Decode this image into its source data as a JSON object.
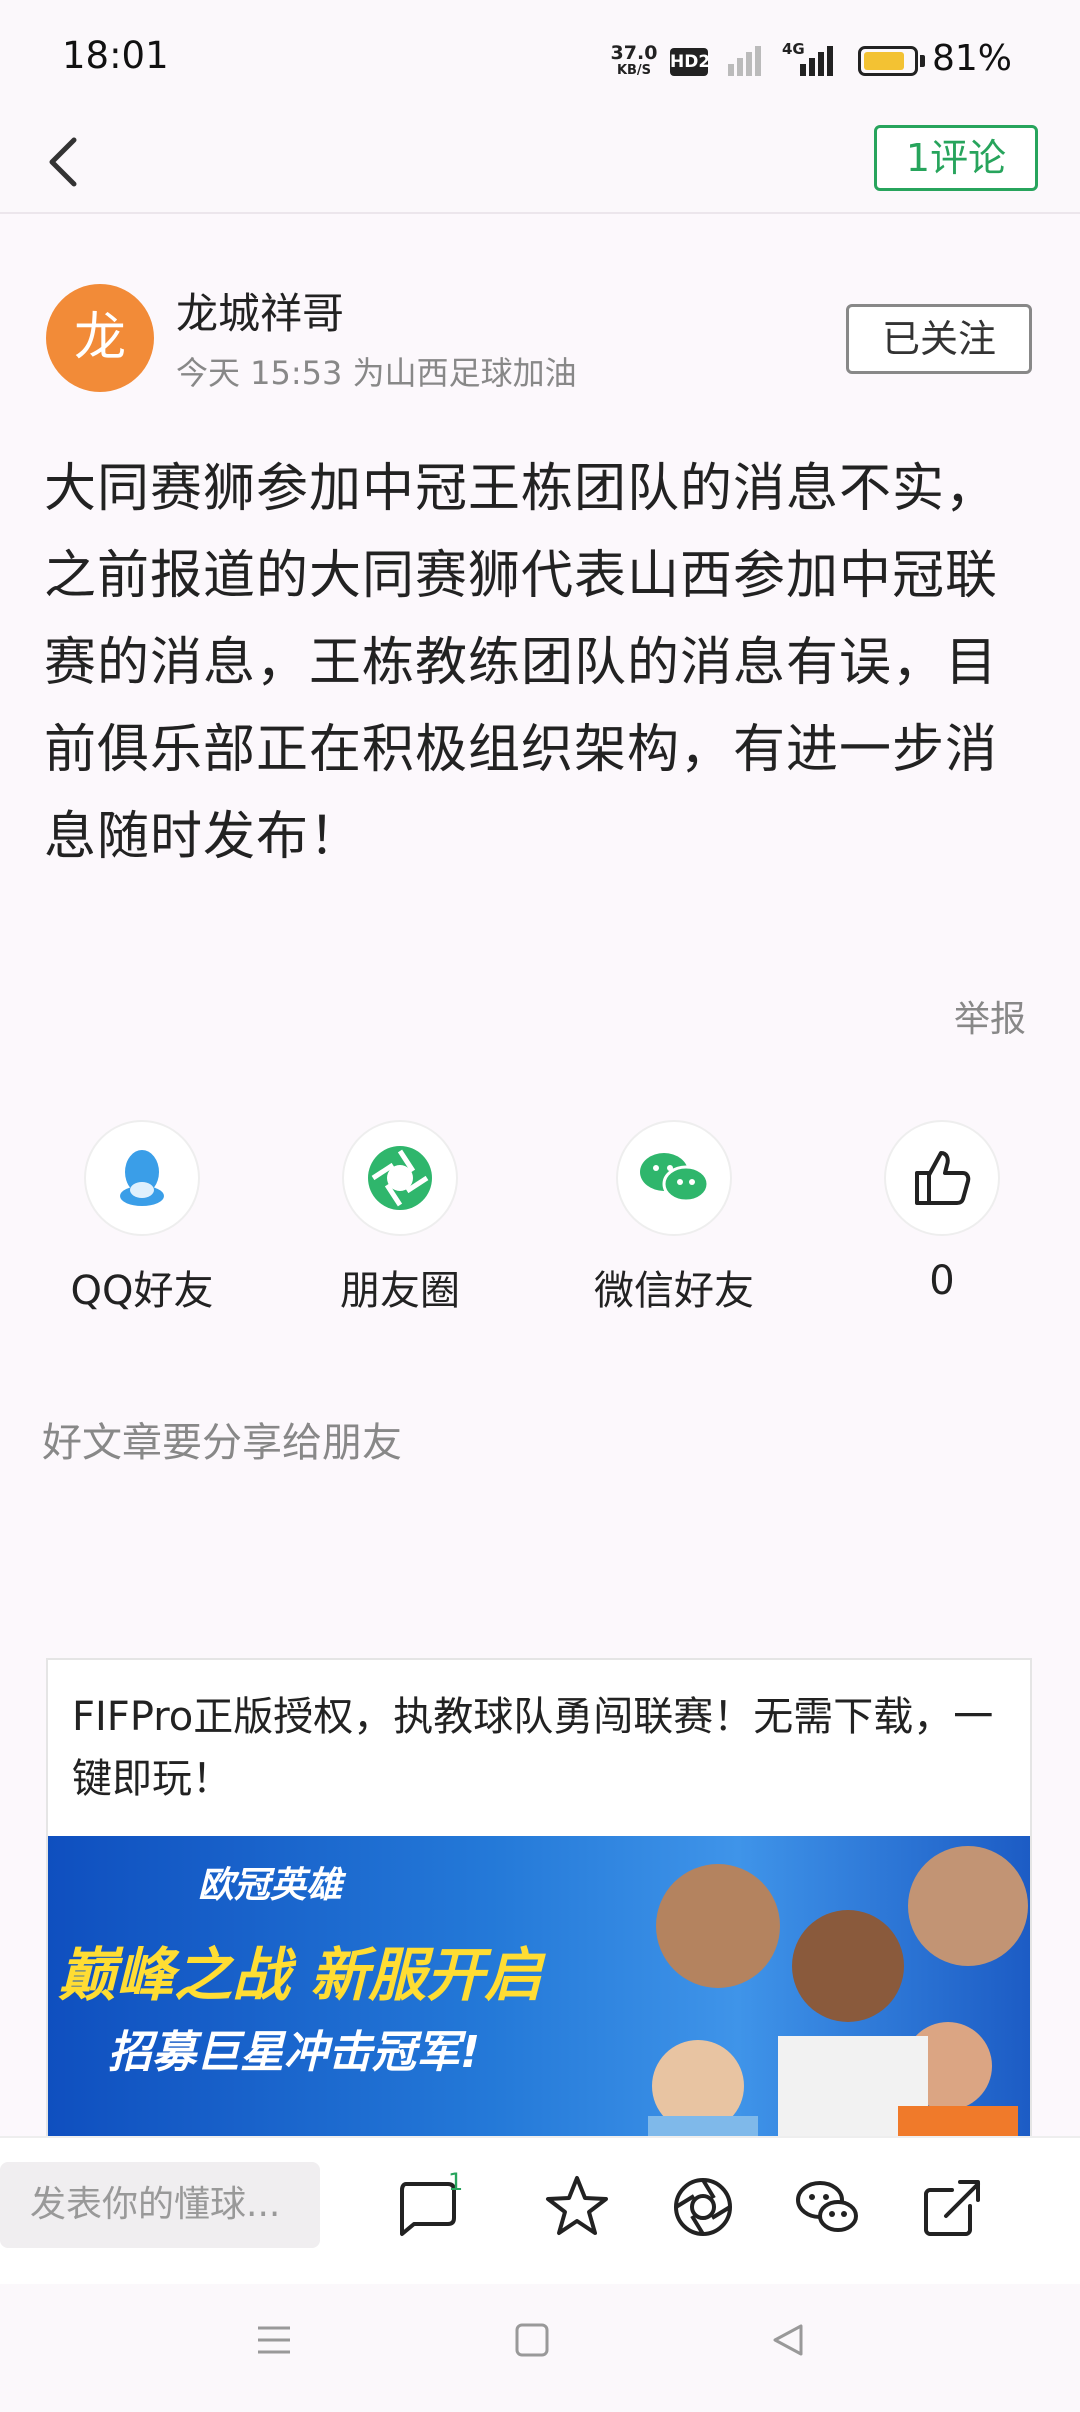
{
  "status_bar": {
    "time": "18:01",
    "net_speed_value": "37.0",
    "net_speed_unit": "KB/S",
    "hd_badge": "HD2",
    "network": "4G",
    "battery": "81%"
  },
  "nav": {
    "comment_button": "1评论"
  },
  "author": {
    "avatar_char": "龙",
    "name": "龙城祥哥",
    "meta": "今天 15:53  为山西足球加油",
    "follow_button": "已关注"
  },
  "post": {
    "content": "大同赛狮参加中冠王栋团队的消息不实，之前报道的大同赛狮代表山西参加中冠联赛的消息，王栋教练团队的消息有误，目前俱乐部正在积极组织架构，有进一步消息随时发布！",
    "report": "举报"
  },
  "share": {
    "items": [
      {
        "label": "QQ好友",
        "icon": "qq-icon"
      },
      {
        "label": "朋友圈",
        "icon": "moments-icon"
      },
      {
        "label": "微信好友",
        "icon": "wechat-icon"
      },
      {
        "label": "0",
        "icon": "thumbs-up-icon"
      }
    ],
    "hint": "好文章要分享给朋友"
  },
  "ad": {
    "text": "FIFPro正版授权，执教球队勇闯联赛！无需下载，一键即玩！",
    "logo": "欧冠英雄",
    "headline": "巅峰之战 新服开启",
    "subline": "招募巨星冲击冠军!"
  },
  "toolbar": {
    "comment_placeholder": "发表你的懂球...",
    "comment_count": "1"
  },
  "colors": {
    "accent": "#27a45c",
    "avatar": "#f28b38",
    "background": "#fcf8fc"
  }
}
